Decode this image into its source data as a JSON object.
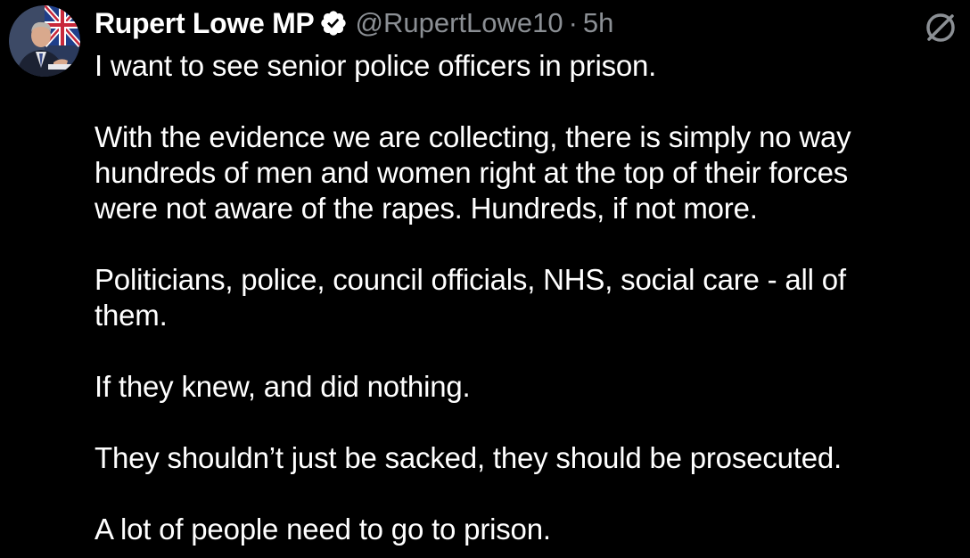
{
  "author": {
    "name": "Rupert Lowe MP",
    "handle": "@RupertLowe10",
    "separator": "·",
    "time": "5h",
    "verified_icon": "verified-badge-icon",
    "avatar_icon": "profile-photo"
  },
  "tweet": {
    "paragraphs": [
      "I want to see senior police officers in prison.",
      "With the evidence we are collecting, there is simply no way\nhundreds of men and women right at the top of their forces\nwere not aware of the rapes. Hundreds, if not more.",
      "Politicians, police, council officials, NHS, social care - all of\nthem.",
      "If they knew, and did nothing.",
      "They shouldn’t just be sacked, they should be prosecuted.",
      "A lot of people need to go to prison."
    ]
  },
  "colors": {
    "background": "#000000",
    "text": "#ffffff",
    "secondary": "#8b8f94",
    "verified": "#ffffff"
  },
  "menu_icon": "slashed-circle-icon"
}
